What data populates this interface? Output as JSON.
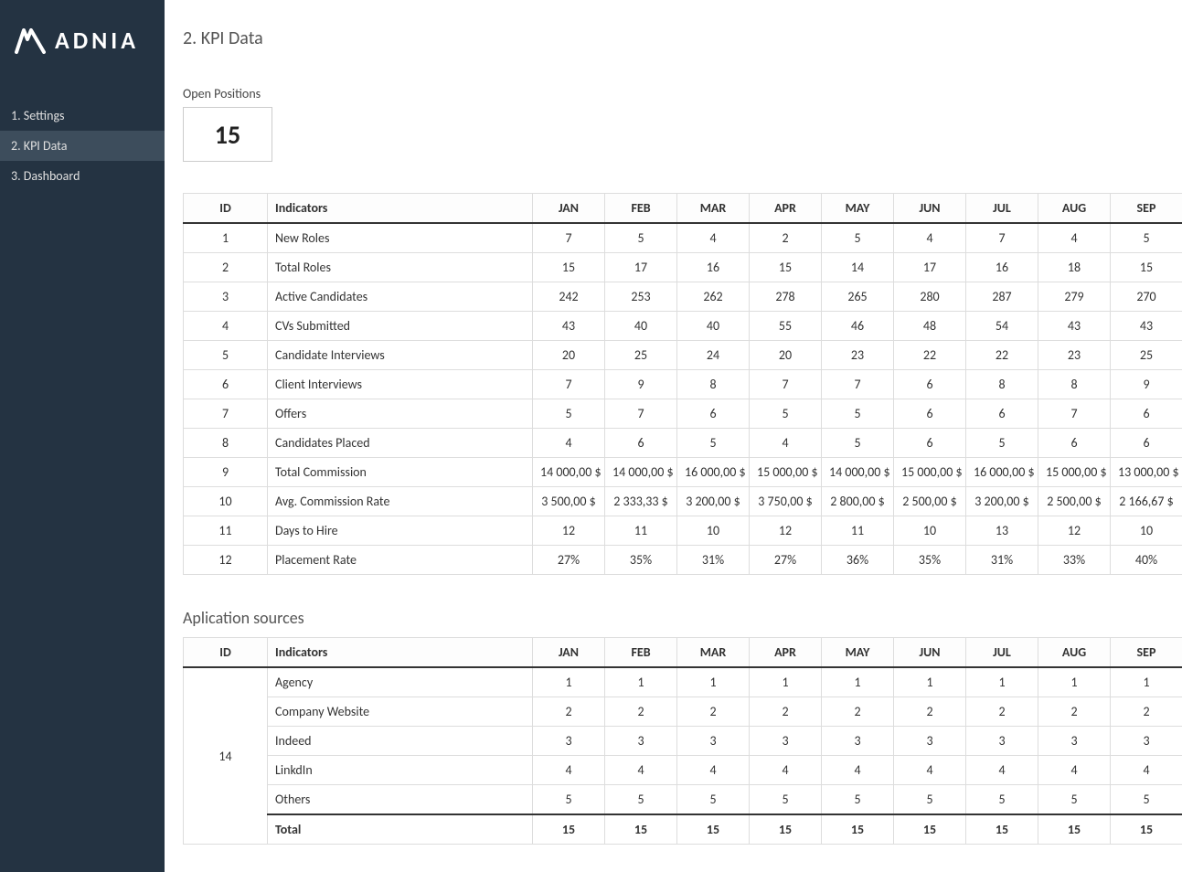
{
  "brand": "ADNIA",
  "sidebar": {
    "items": [
      {
        "label": "1. Settings",
        "active": false
      },
      {
        "label": "2. KPI Data",
        "active": true
      },
      {
        "label": "3. Dashboard",
        "active": false
      }
    ]
  },
  "page_title": "2. KPI Data",
  "open_positions": {
    "label": "Open Positions",
    "value": "15"
  },
  "months": [
    "JAN",
    "FEB",
    "MAR",
    "APR",
    "MAY",
    "JUN",
    "JUL",
    "AUG",
    "SEP"
  ],
  "col_headers": {
    "id": "ID",
    "indicators": "Indicators"
  },
  "kpi_rows": [
    {
      "id": "1",
      "name": "New Roles",
      "vals": [
        "7",
        "5",
        "4",
        "2",
        "5",
        "4",
        "7",
        "4",
        "5"
      ]
    },
    {
      "id": "2",
      "name": "Total Roles",
      "vals": [
        "15",
        "17",
        "16",
        "15",
        "14",
        "17",
        "16",
        "18",
        "15"
      ]
    },
    {
      "id": "3",
      "name": "Active Candidates",
      "vals": [
        "242",
        "253",
        "262",
        "278",
        "265",
        "280",
        "287",
        "279",
        "270"
      ]
    },
    {
      "id": "4",
      "name": "CVs Submitted",
      "vals": [
        "43",
        "40",
        "40",
        "55",
        "46",
        "48",
        "54",
        "43",
        "43"
      ]
    },
    {
      "id": "5",
      "name": "Candidate Interviews",
      "vals": [
        "20",
        "25",
        "24",
        "20",
        "23",
        "22",
        "22",
        "23",
        "25"
      ]
    },
    {
      "id": "6",
      "name": "Client Interviews",
      "vals": [
        "7",
        "9",
        "8",
        "7",
        "7",
        "6",
        "8",
        "8",
        "9"
      ]
    },
    {
      "id": "7",
      "name": "Offers",
      "vals": [
        "5",
        "7",
        "6",
        "5",
        "5",
        "6",
        "6",
        "7",
        "6"
      ]
    },
    {
      "id": "8",
      "name": "Candidates Placed",
      "vals": [
        "4",
        "6",
        "5",
        "4",
        "5",
        "6",
        "5",
        "6",
        "6"
      ]
    },
    {
      "id": "9",
      "name": "Total Commission",
      "vals": [
        "14 000,00 $",
        "14 000,00 $",
        "16 000,00 $",
        "15 000,00 $",
        "14 000,00 $",
        "15 000,00 $",
        "16 000,00 $",
        "15 000,00 $",
        "13 000,00 $"
      ]
    },
    {
      "id": "10",
      "name": "Avg. Commission Rate",
      "vals": [
        "3 500,00 $",
        "2 333,33 $",
        "3 200,00 $",
        "3 750,00 $",
        "2 800,00 $",
        "2 500,00 $",
        "3 200,00 $",
        "2 500,00 $",
        "2 166,67 $"
      ]
    },
    {
      "id": "11",
      "name": "Days to Hire",
      "vals": [
        "12",
        "11",
        "10",
        "12",
        "11",
        "10",
        "13",
        "12",
        "10"
      ]
    },
    {
      "id": "12",
      "name": "Placement Rate",
      "vals": [
        "27%",
        "35%",
        "31%",
        "27%",
        "36%",
        "35%",
        "31%",
        "33%",
        "40%"
      ]
    }
  ],
  "sources_title": "Aplication sources",
  "sources_id": "14",
  "sources_rows": [
    {
      "name": "Agency",
      "vals": [
        "1",
        "1",
        "1",
        "1",
        "1",
        "1",
        "1",
        "1",
        "1"
      ]
    },
    {
      "name": "Company Website",
      "vals": [
        "2",
        "2",
        "2",
        "2",
        "2",
        "2",
        "2",
        "2",
        "2"
      ]
    },
    {
      "name": "Indeed",
      "vals": [
        "3",
        "3",
        "3",
        "3",
        "3",
        "3",
        "3",
        "3",
        "3"
      ]
    },
    {
      "name": "LinkdIn",
      "vals": [
        "4",
        "4",
        "4",
        "4",
        "4",
        "4",
        "4",
        "4",
        "4"
      ]
    },
    {
      "name": "Others",
      "vals": [
        "5",
        "5",
        "5",
        "5",
        "5",
        "5",
        "5",
        "5",
        "5"
      ]
    }
  ],
  "sources_total": {
    "name": "Total",
    "vals": [
      "15",
      "15",
      "15",
      "15",
      "15",
      "15",
      "15",
      "15",
      "15"
    ]
  }
}
